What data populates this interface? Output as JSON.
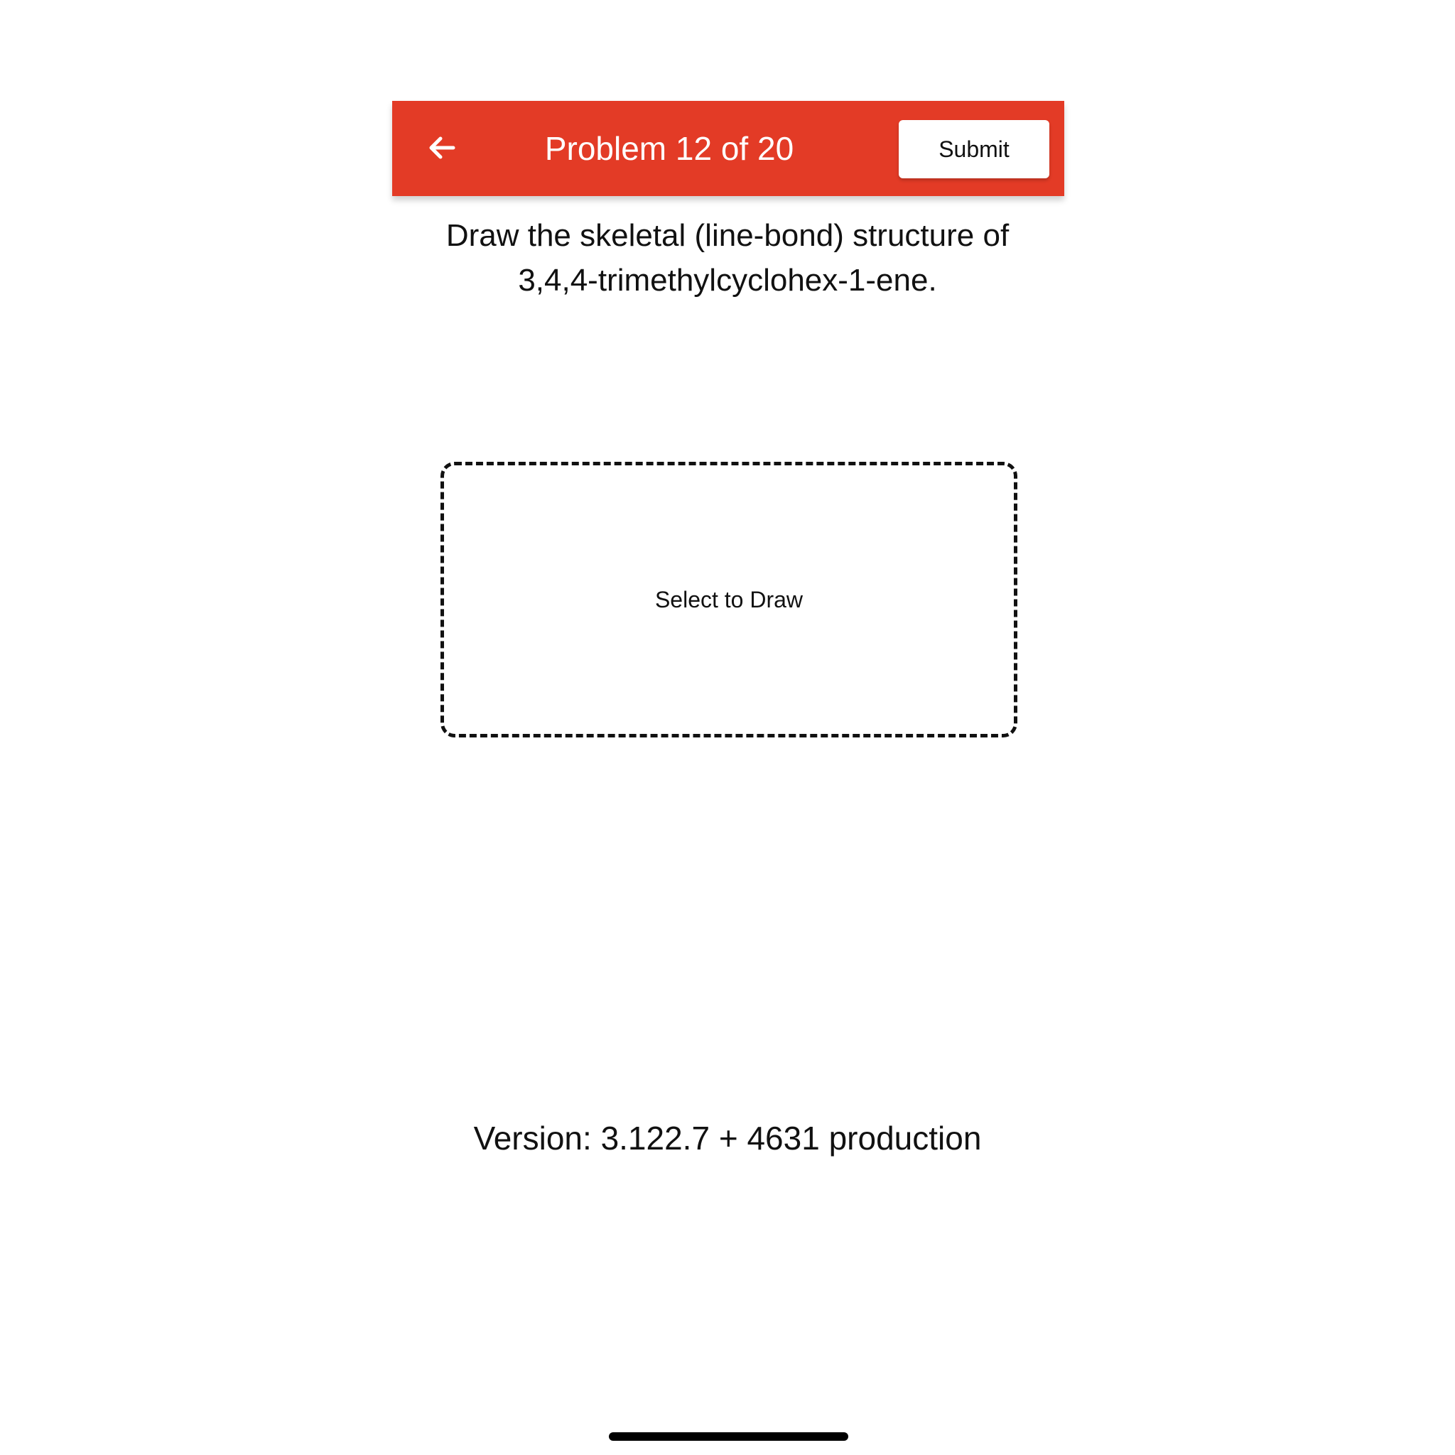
{
  "header": {
    "back_icon": "arrow-left-icon",
    "title": "Problem 12 of 20",
    "submit_label": "Submit",
    "background_color": "#e33b26"
  },
  "question": {
    "text": "Draw the skeletal (line-bond) structure of 3,4,4-trimethylcyclohex-1-ene."
  },
  "draw_area": {
    "label": "Select to Draw"
  },
  "footer": {
    "version": "Version: 3.122.7 + 4631 production"
  }
}
